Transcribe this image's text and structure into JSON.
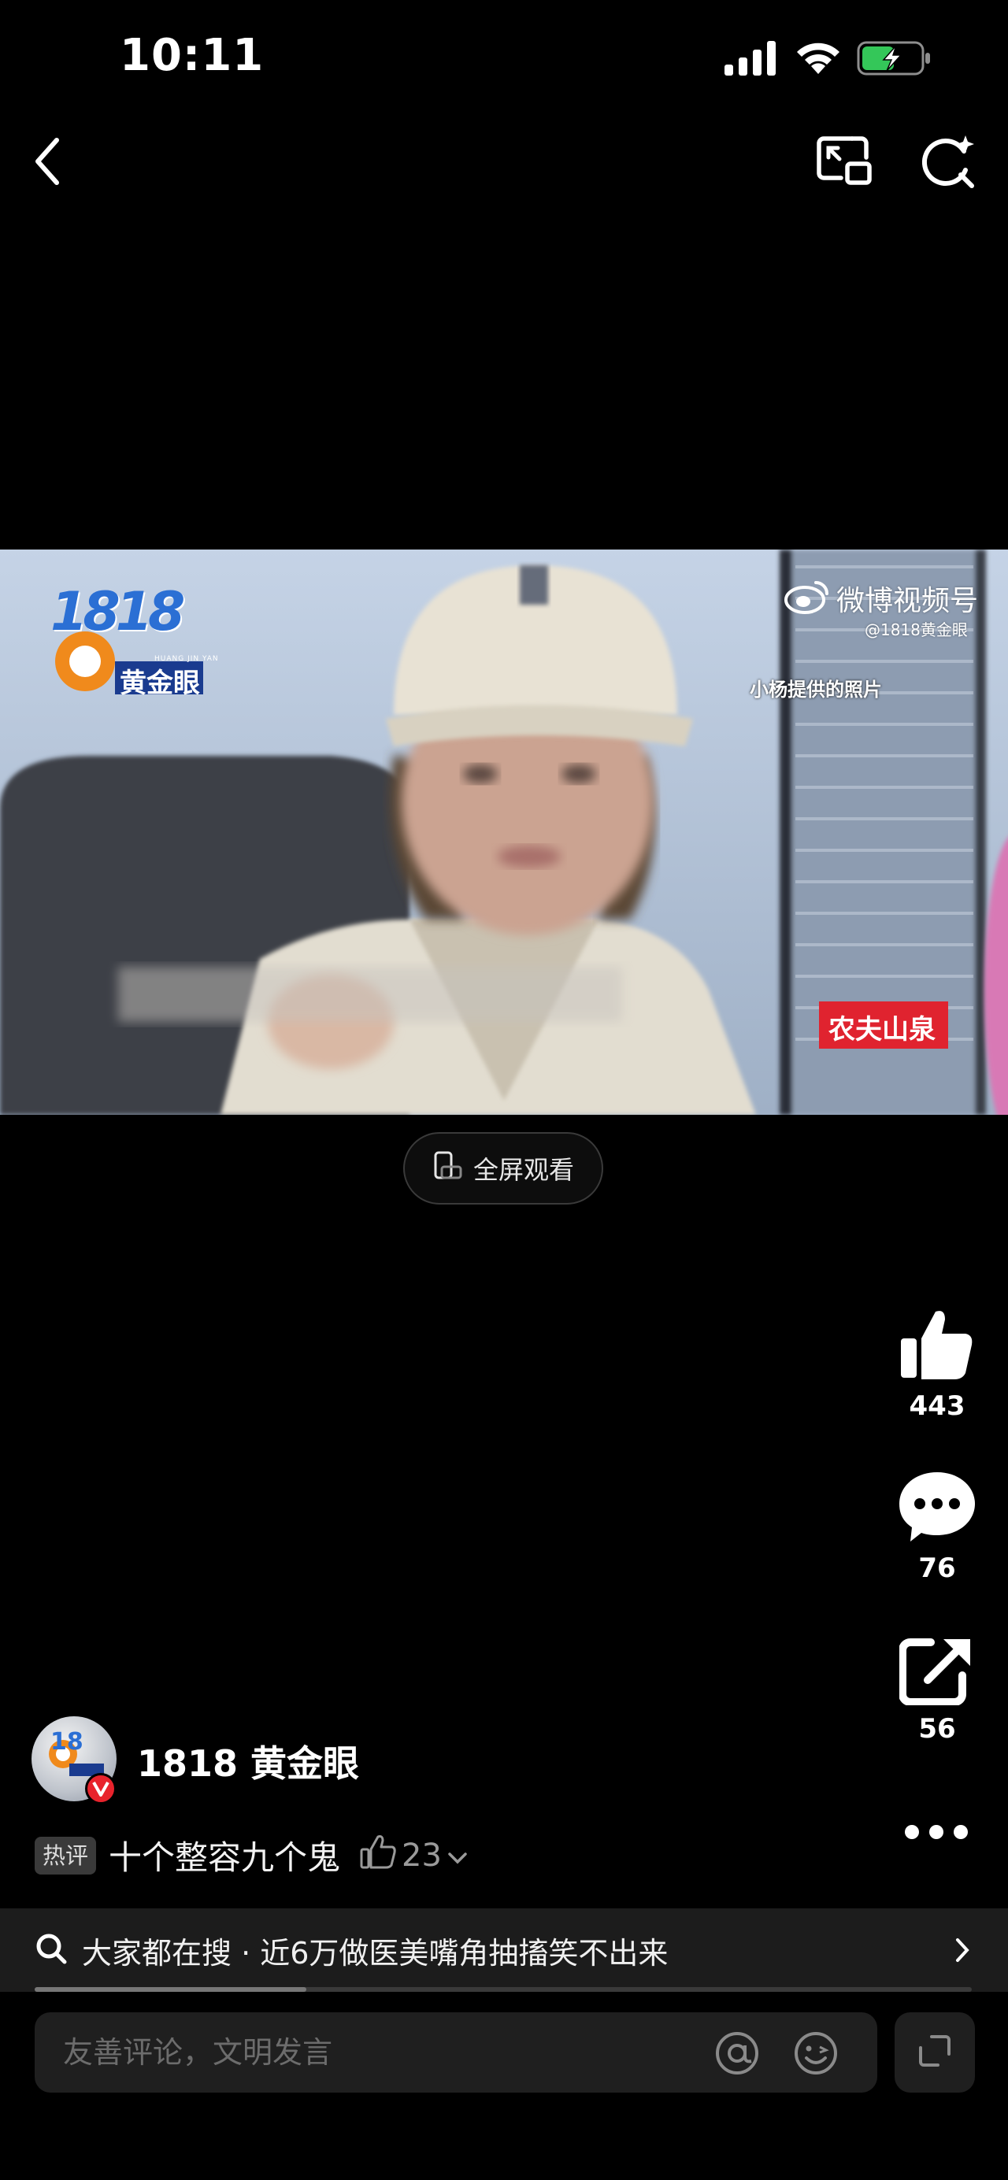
{
  "status_bar": {
    "time": "10:11"
  },
  "video": {
    "watermark_brand": "1818",
    "watermark_brand_cn": "黄金眼",
    "watermark_sub": "HUANG JIN YAN",
    "platform_watermark": "微博视频号",
    "platform_handle": "@1818黄金眼",
    "caption": "小杨提供的照片",
    "sponsor": "农夫山泉"
  },
  "fullscreen_label": "全屏观看",
  "actions": {
    "like_count": "443",
    "comment_count": "76",
    "share_count": "56"
  },
  "author": {
    "name": "1818 黄金眼"
  },
  "hot_comment": {
    "tag": "热评",
    "text": "十个整容九个鬼",
    "likes": "23"
  },
  "search_banner": {
    "label": "大家都在搜 · 近6万做医美嘴角抽搐笑不出来",
    "progress": 0.29
  },
  "comment_input": {
    "placeholder": "友善评论，文明发言"
  }
}
